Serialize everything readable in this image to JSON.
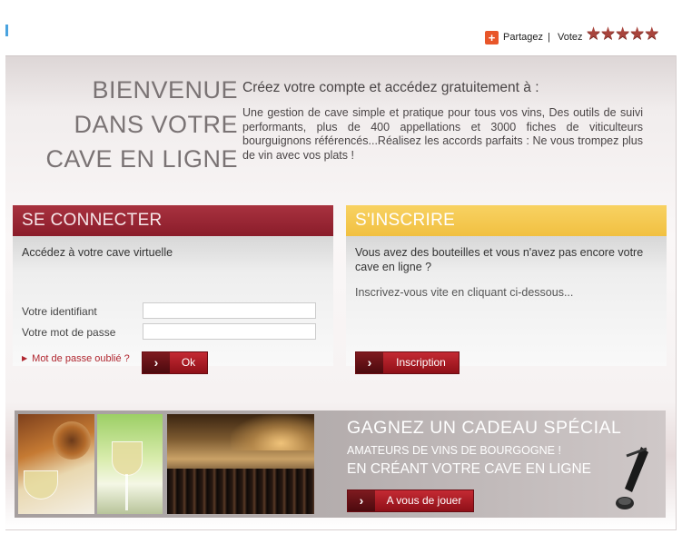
{
  "header": {
    "share_label": "Partagez",
    "separator": "|",
    "vote_label": "Votez",
    "stars": 5
  },
  "welcome": {
    "title_lines": [
      "BIENVENUE",
      "DANS VOTRE",
      "CAVE EN LIGNE"
    ],
    "lead": "Créez votre compte et accédez gratuitement à :",
    "text": "Une gestion de cave simple et pratique pour tous vos vins, Des outils de suivi performants, plus de 400 appellations et 3000 fiches de viticulteurs bourguignons référencés...Réalisez les accords parfaits : Ne vous trompez plus de vin avec vos plats !"
  },
  "login": {
    "heading": "SE CONNECTER",
    "title": "Accédez à votre cave virtuelle",
    "id_label": "Votre identifiant",
    "password_label": "Votre mot de passe",
    "id_value": "",
    "password_value": "",
    "forgot": "Mot de passe oublié ?",
    "ok_label": "Ok"
  },
  "signup": {
    "heading": "S'INSCRIRE",
    "question": "Vous avez des bouteilles et vous n'avez pas encore votre cave en ligne ?",
    "hint": "Inscrivez-vous vite en cliquant ci-dessous...",
    "button_label": "Inscription"
  },
  "promo": {
    "title": "GAGNEZ UN CADEAU SPÉCIAL",
    "subtitle": "AMATEURS DE VINS DE BOURGOGNE !",
    "subtitle2": "EN CRÉANT VOTRE CAVE EN LIGNE",
    "button_label": "A vous de jouer"
  },
  "colors": {
    "accent_red": "#8a1c2a",
    "accent_yellow": "#f1c041",
    "share_orange": "#e8562a"
  }
}
